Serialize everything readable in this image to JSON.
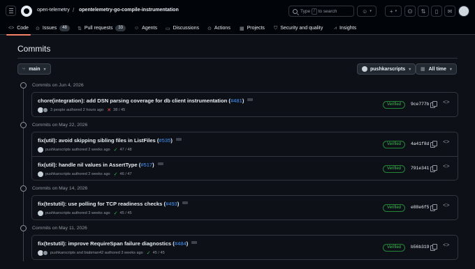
{
  "header": {
    "owner": "open-telemetry",
    "repo": "opentelemetry-go-compile-instrumentation",
    "search_placeholder_pre": "Type",
    "search_key": "/",
    "search_placeholder_post": "to search"
  },
  "tabs": [
    {
      "label": "Code",
      "icon": "code-icon",
      "active": true
    },
    {
      "label": "Issues",
      "icon": "issue-icon",
      "count": "48"
    },
    {
      "label": "Pull requests",
      "icon": "pr-icon",
      "count": "33"
    },
    {
      "label": "Agents",
      "icon": "agent-icon"
    },
    {
      "label": "Discussions",
      "icon": "discussion-icon"
    },
    {
      "label": "Actions",
      "icon": "play-icon"
    },
    {
      "label": "Projects",
      "icon": "table-icon"
    },
    {
      "label": "Security and quality",
      "icon": "shield-icon"
    },
    {
      "label": "Insights",
      "icon": "graph-icon"
    }
  ],
  "page": {
    "title": "Commits",
    "branch": "main",
    "user_filter": "pushkarscripts",
    "time_filter": "All time"
  },
  "groups": [
    {
      "date": "Commits on Jun 4, 2026",
      "commits": [
        {
          "message": "chore(integration): add DSN parsing coverage for db client instrumentation (",
          "pr": "#481",
          "close": ")",
          "authors": "3 people",
          "when": "authored 2 hours ago",
          "checks": "38 / 45",
          "status": "fail",
          "badge": "Verified",
          "sha": "9ce777b"
        }
      ]
    },
    {
      "date": "Commits on May 22, 2026",
      "commits": [
        {
          "message": "fix(util): avoid skipping sibling files in ListFiles (",
          "pr": "#535",
          "close": ")",
          "authors": "pushkarscripts",
          "when": "authored 2 weeks ago",
          "checks": "47 / 48",
          "status": "ok",
          "badge": "Verified",
          "sha": "4a41f8d"
        },
        {
          "message": "fix(util): handle nil values in AssertType (",
          "pr": "#517",
          "close": ")",
          "authors": "pushkarscripts",
          "when": "authored 2 weeks ago",
          "checks": "46 / 47",
          "status": "ok",
          "badge": "Verified",
          "sha": "791e341"
        }
      ]
    },
    {
      "date": "Commits on May 14, 2026",
      "commits": [
        {
          "message": "fix(testutil): use polling for TCP readiness checks (",
          "pr": "#493",
          "close": ")",
          "authors": "pushkarscripts",
          "when": "authored 3 weeks ago",
          "checks": "45 / 45",
          "status": "ok",
          "badge": "Verified",
          "sha": "e88e6f5"
        }
      ]
    },
    {
      "date": "Commits on May 11, 2026",
      "commits": [
        {
          "message": "fix(testutil): improve RequireSpan failure diagnostics (",
          "pr": "#484",
          "close": ")",
          "authors": "pushkarscripts and biabman42",
          "when": "authored 3 weeks ago",
          "checks": "45 / 45",
          "status": "ok",
          "badge": "Verified",
          "sha": "b56b319"
        }
      ]
    }
  ]
}
